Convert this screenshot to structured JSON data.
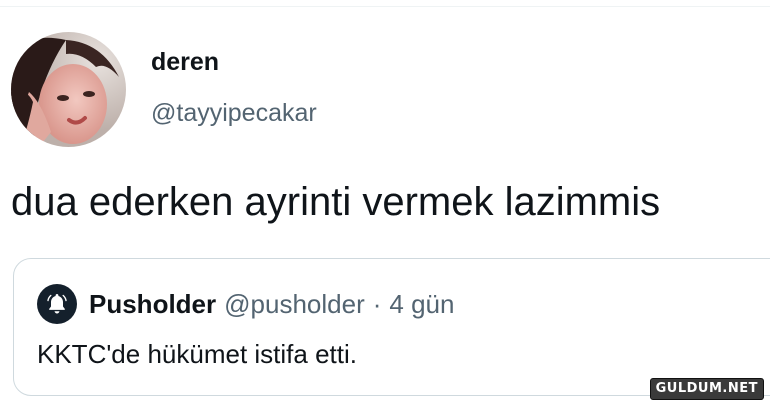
{
  "tweet": {
    "author_name": "deren",
    "author_handle": "@tayyipecakar",
    "text": "dua ederken ayrinti vermek lazimmis"
  },
  "quoted_tweet": {
    "author_name": "Pusholder",
    "author_handle": "@pusholder",
    "separator": "·",
    "time": "4 gün",
    "text": "KKTC'de hükümet istifa etti.",
    "avatar_icon": "bell-icon"
  },
  "watermark": {
    "text": "GULDUM.NET"
  },
  "colors": {
    "primary_text": "#0f1419",
    "secondary_text": "#536471",
    "card_border": "#cfd9de",
    "quote_avatar_bg": "#14202c"
  }
}
